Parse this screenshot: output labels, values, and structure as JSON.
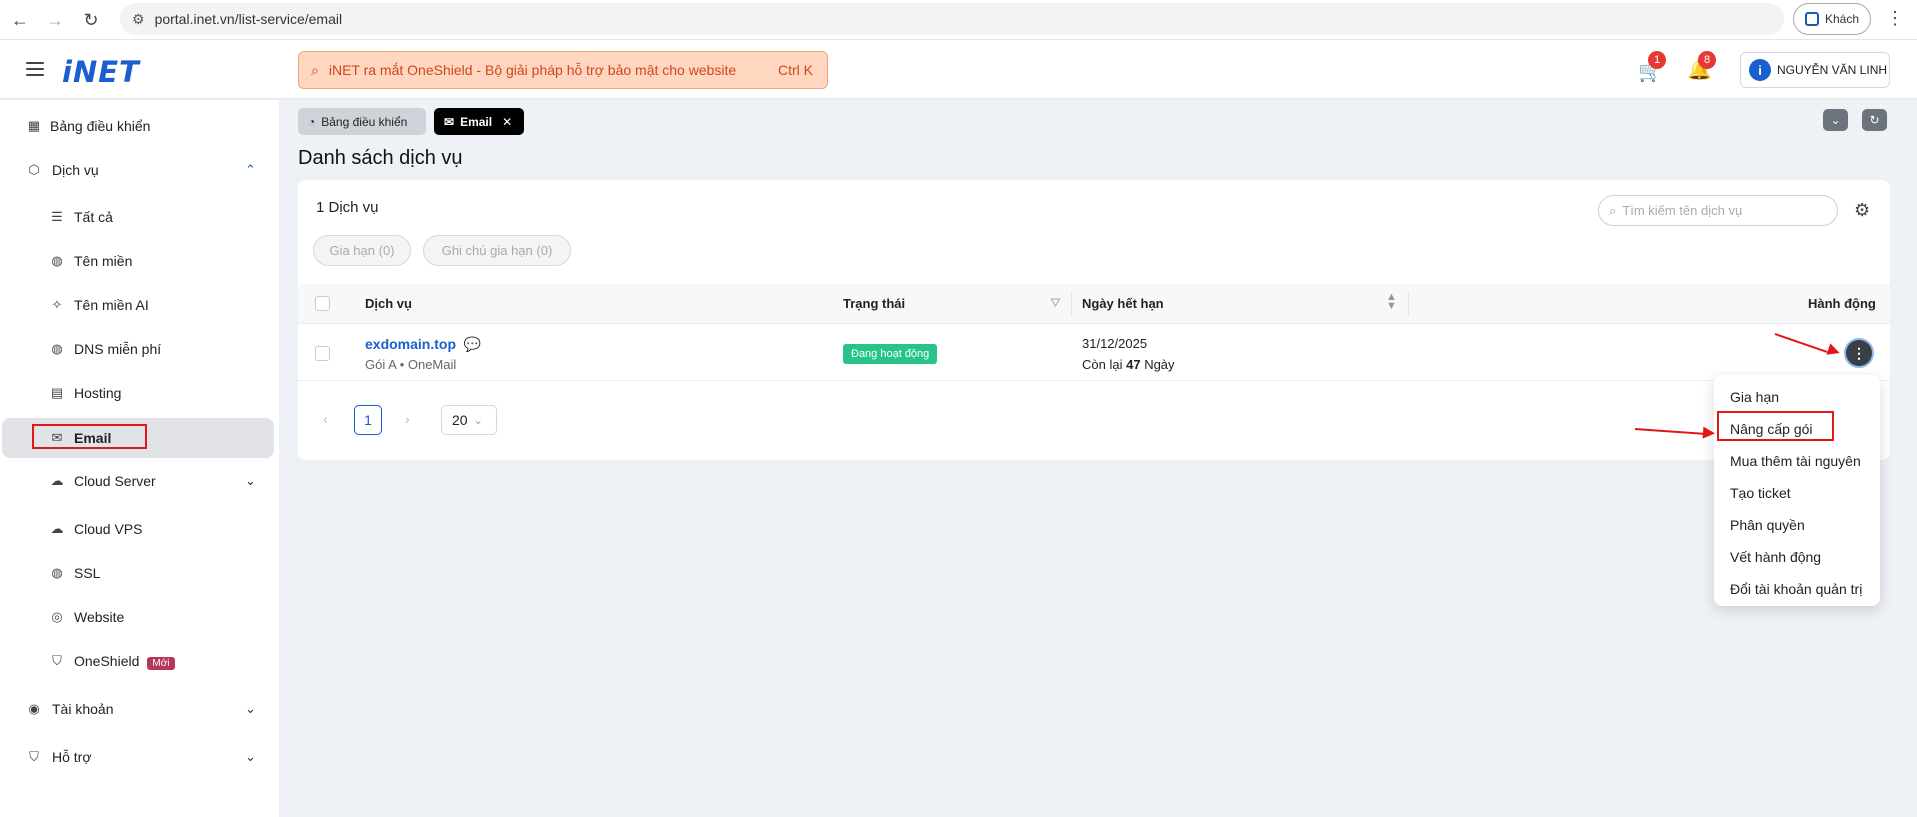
{
  "browser": {
    "url": "portal.inet.vn/list-service/email",
    "guest_label": "Khách"
  },
  "header": {
    "logo": "iNET",
    "announcement": "iNET ra mắt OneShield - Bộ giải pháp hỗ trợ bảo mật cho website",
    "shortcut": "Ctrl K",
    "cart_count": "1",
    "notification_count": "8",
    "user_name": "NGUYỄN VĂN LINH"
  },
  "sidebar": {
    "items": [
      {
        "label": "Bảng điều khiển",
        "icon": "dashboard-icon"
      },
      {
        "label": "Dịch vụ",
        "icon": "box-icon"
      },
      {
        "label": "Tất cả",
        "icon": "table-icon"
      },
      {
        "label": "Tên miền",
        "icon": "globe-icon"
      },
      {
        "label": "Tên miền AI",
        "icon": "sparkle-icon"
      },
      {
        "label": "DNS miễn phí",
        "icon": "globe-icon"
      },
      {
        "label": "Hosting",
        "icon": "server-icon"
      },
      {
        "label": "Email",
        "icon": "mail-icon"
      },
      {
        "label": "Cloud Server",
        "icon": "cloud-server-icon"
      },
      {
        "label": "Cloud VPS",
        "icon": "cloud-icon"
      },
      {
        "label": "SSL",
        "icon": "ssl-globe-icon"
      },
      {
        "label": "Website",
        "icon": "website-icon"
      },
      {
        "label": "OneShield",
        "icon": "shield-icon"
      },
      {
        "label": "Tài khoản",
        "icon": "user-circle-icon"
      },
      {
        "label": "Hỗ trợ",
        "icon": "support-shield-icon"
      }
    ],
    "new_tag": "Mới"
  },
  "tabs": {
    "dashboard": "Bảng điều khiển",
    "email": "Email",
    "close": "✕"
  },
  "page": {
    "title": "Danh sách dịch vụ"
  },
  "card": {
    "service_count": "1 Dịch vụ",
    "search_placeholder": "Tìm kiếm tên dịch vụ",
    "filters": [
      "Gia hạn (0)",
      "Ghi chú gia hạn (0)"
    ],
    "columns": [
      "Dịch vụ",
      "Trạng thái",
      "Ngày hết hạn",
      "Hành động"
    ],
    "rows": [
      {
        "service": "exdomain.top",
        "subtitle": "Gói A  •  OneMail",
        "status": "Đang hoạt động",
        "expiry": "31/12/2025",
        "remaining_prefix": "Còn lại",
        "remaining_days": "47",
        "remaining_suffix": "Ngày"
      }
    ],
    "pagination": {
      "current": "1",
      "page_size": "20"
    }
  },
  "action_menu": {
    "items": [
      "Gia hạn",
      "Nâng cấp gói",
      "Mua thêm tài nguyên",
      "Tạo ticket",
      "Phân quyền",
      "Vết hành động",
      "Đổi tài khoản quản trị"
    ]
  },
  "colors": {
    "brand": "#1a5fcf",
    "status_active": "#27c48a",
    "annotation": "#e01818",
    "announcement_bg": "#ffd7c0"
  }
}
